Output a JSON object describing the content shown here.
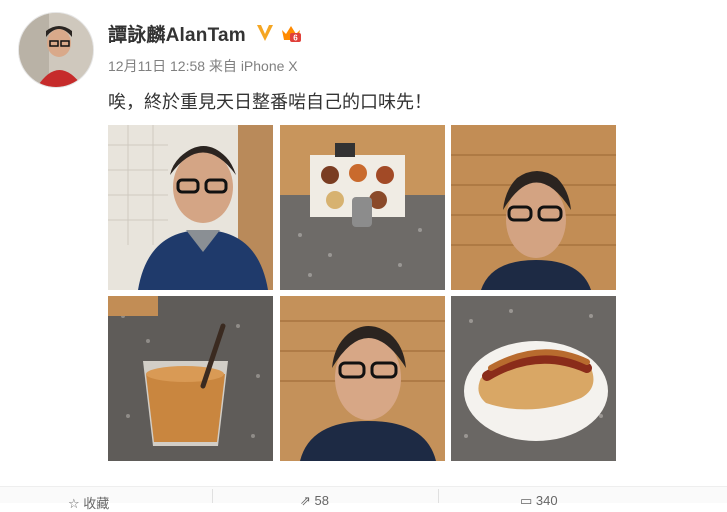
{
  "post": {
    "author": "譚詠麟AlanTam",
    "verified_icon": "verified-v-icon",
    "level_icon": "crown-level-icon",
    "level_badge": "6",
    "time": "12月11日 12:58",
    "source_prefix": "来自",
    "source": "iPhone X",
    "text": "唉，終於重見天日整番啱自己的口味先！"
  },
  "photos": [
    {
      "name": "photo-selfie-office"
    },
    {
      "name": "photo-menu-stand"
    },
    {
      "name": "photo-selfie-wood-wall"
    },
    {
      "name": "photo-milk-tea"
    },
    {
      "name": "photo-selfie-closeup"
    },
    {
      "name": "photo-hotdog"
    }
  ],
  "actions": {
    "favorite": "收藏",
    "repost": "58",
    "comment": "340"
  },
  "colors": {
    "text": "#333333",
    "meta": "#808080",
    "verified": "#f5a623",
    "crown": "#ff8a00"
  }
}
